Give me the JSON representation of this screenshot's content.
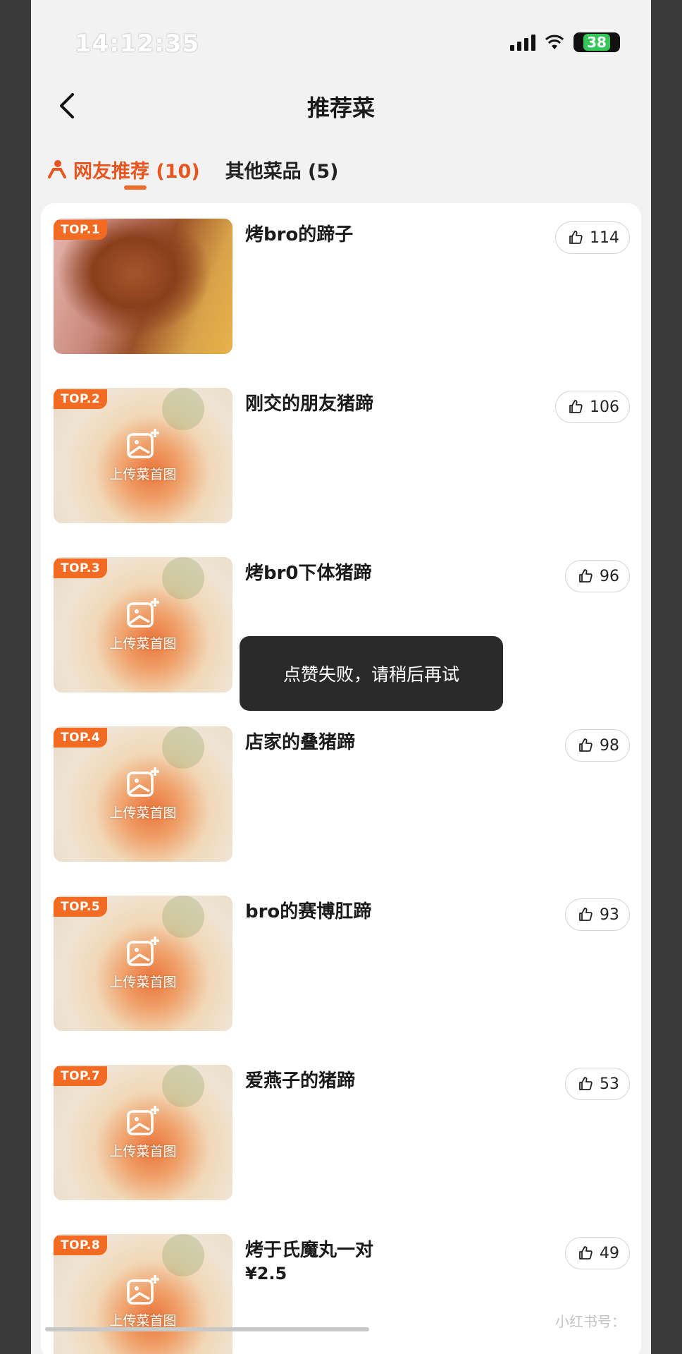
{
  "status_bar": {
    "time": "14:12:35",
    "battery": "38"
  },
  "nav": {
    "title": "推荐菜"
  },
  "tabs": [
    {
      "label": "网友推荐 (10)",
      "active": true
    },
    {
      "label": "其他菜品 (5)",
      "active": false
    }
  ],
  "items": [
    {
      "rank": "TOP.1",
      "name": "烤bro的蹄子",
      "likes": "114",
      "has_photo": true
    },
    {
      "rank": "TOP.2",
      "name": "刚交的朋友猪蹄",
      "likes": "106",
      "upload_label": "上传菜首图"
    },
    {
      "rank": "TOP.3",
      "name": "烤br0下体猪蹄",
      "likes": "96",
      "upload_label": "上传菜首图"
    },
    {
      "rank": "TOP.4",
      "name": "店家的叠猪蹄",
      "likes": "98",
      "upload_label": "上传菜首图"
    },
    {
      "rank": "TOP.5",
      "name": "bro的赛博肛蹄",
      "likes": "93",
      "upload_label": "上传菜首图"
    },
    {
      "rank": "TOP.7",
      "name": "爱燕子的猪蹄",
      "likes": "53",
      "upload_label": "上传菜首图"
    },
    {
      "rank": "TOP.8",
      "name": "烤于氏魔丸一对",
      "price": "¥2.5",
      "likes": "49",
      "upload_label": "上传菜首图"
    }
  ],
  "toast": {
    "message": "点赞失败，请稍后再试"
  },
  "watermark": "小红书号：",
  "colors": {
    "accent": "#f26a2a",
    "toast_bg": "#2a2a2a",
    "card_bg": "#ffffff"
  },
  "icons": {
    "back": "chevron-left-icon",
    "like": "thumbs-up-icon",
    "upload": "image-plus-icon",
    "tab_people": "people-icon"
  }
}
